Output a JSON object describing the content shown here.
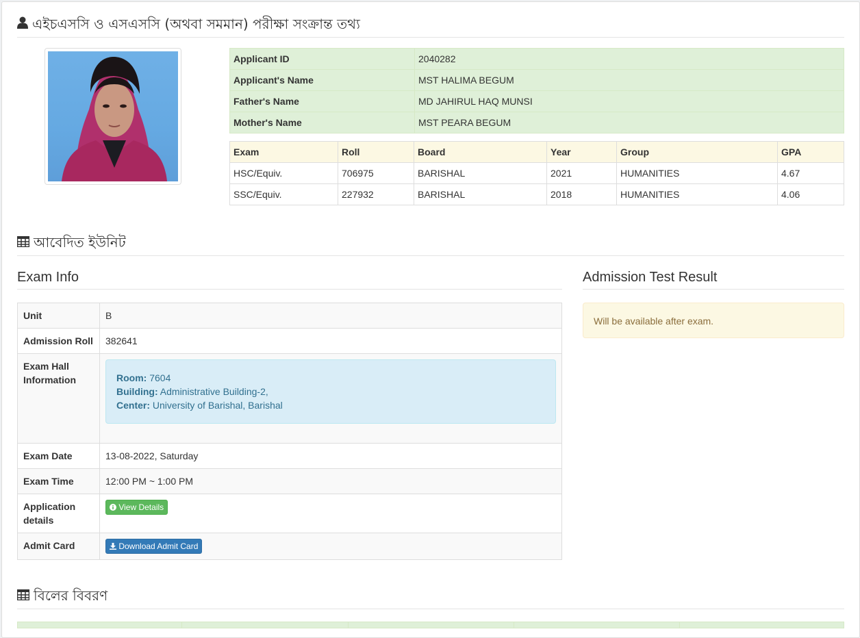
{
  "headings": {
    "exam_info_section": "এইচএসসি ও এসএসসি (অথবা সমমান) পরীক্ষা সংক্রান্ত তথ্য",
    "applied_units": "আবেদিত ইউনিট",
    "bill_details": "বিলের বিবরণ",
    "exam_info": "Exam Info",
    "admission_result": "Admission Test Result"
  },
  "applicant": {
    "rows": [
      {
        "label": "Applicant ID",
        "value": "2040282"
      },
      {
        "label": "Applicant's Name",
        "value": "MST HALIMA BEGUM"
      },
      {
        "label": "Father's Name",
        "value": "MD JAHIRUL HAQ MUNSI"
      },
      {
        "label": "Mother's Name",
        "value": "MST PEARA BEGUM"
      }
    ]
  },
  "academic": {
    "headers": [
      "Exam",
      "Roll",
      "Board",
      "Year",
      "Group",
      "GPA"
    ],
    "rows": [
      [
        "HSC/Equiv.",
        "706975",
        "BARISHAL",
        "2021",
        "HUMANITIES",
        "4.67"
      ],
      [
        "SSC/Equiv.",
        "227932",
        "BARISHAL",
        "2018",
        "HUMANITIES",
        "4.06"
      ]
    ]
  },
  "exam_info": {
    "unit_label": "Unit",
    "unit_value": "B",
    "roll_label": "Admission Roll",
    "roll_value": "382641",
    "hall_label": "Exam Hall Information",
    "room_label": "Room:",
    "room_value": "7604",
    "building_label": "Building:",
    "building_value": "Administrative Building-2,",
    "center_label": "Center:",
    "center_value": "University of Barishal, Barishal",
    "date_label": "Exam Date",
    "date_value": "13-08-2022, Saturday",
    "time_label": "Exam Time",
    "time_value": "12:00 PM ~ 1:00 PM",
    "details_label": "Application details",
    "view_details_btn": "View Details",
    "admit_label": "Admit Card",
    "download_btn": "Download Admit Card"
  },
  "admission_result": {
    "message": "Will be available after exam."
  },
  "icons": {
    "user": "user-icon",
    "table": "table-icon",
    "info": "info-circle-icon",
    "download": "download-icon"
  },
  "colors": {
    "success_bg": "#dff0d8",
    "warning_bg": "#fcf8e3",
    "info_bg": "#d9edf7",
    "btn_success": "#5cb85c",
    "btn_primary": "#337ab7"
  }
}
